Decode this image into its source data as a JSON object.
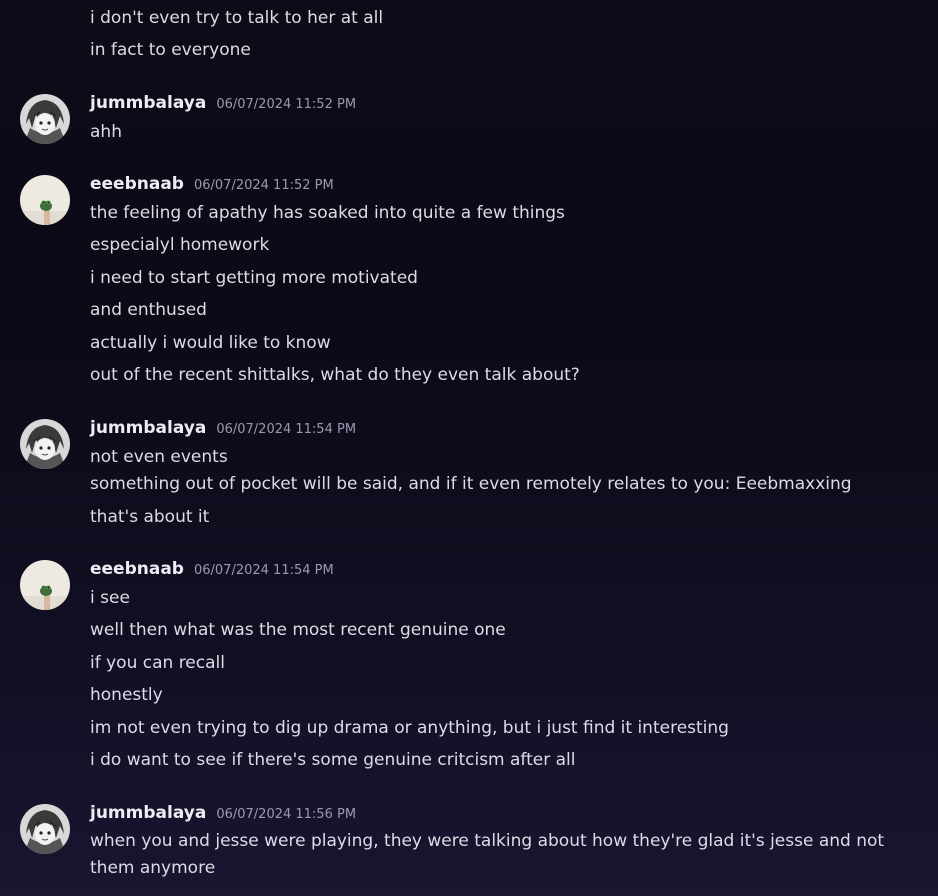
{
  "lead_lines": [
    "i don't even try to talk to her at all",
    "in fact to everyone"
  ],
  "groups": [
    {
      "username": "jummbalaya",
      "timestamp": "06/07/2024 11:52 PM",
      "avatar_icon": "manga-girl-avatar-icon",
      "lines": [
        "ahh"
      ]
    },
    {
      "username": "eeebnaab",
      "timestamp": "06/07/2024 11:52 PM",
      "avatar_icon": "frog-avatar-icon",
      "lines": [
        "the feeling of apathy has soaked into quite a few things",
        "especialyl homework",
        "i need to start getting more motivated",
        "and enthused",
        "actually i would like to know",
        "out of the recent shittalks, what do they even talk about?"
      ]
    },
    {
      "username": "jummbalaya",
      "timestamp": "06/07/2024 11:54 PM",
      "avatar_icon": "manga-girl-avatar-icon",
      "lines": [
        "not even events",
        "something out of pocket will be said, and if it even remotely relates to you: Eeebmaxxing",
        "that's about it"
      ]
    },
    {
      "username": "eeebnaab",
      "timestamp": "06/07/2024 11:54 PM",
      "avatar_icon": "frog-avatar-icon",
      "lines": [
        "i see",
        "well then what was the most recent genuine one",
        "if you can recall",
        "honestly",
        "im not even trying to dig up drama or anything, but i just find it interesting",
        "i do want to see if there's some genuine critcism after all"
      ]
    },
    {
      "username": "jummbalaya",
      "timestamp": "06/07/2024 11:56 PM",
      "avatar_icon": "manga-girl-avatar-icon",
      "lines": [
        "when you and jesse were playing, they were talking about how they're glad it's jesse and not them anymore"
      ]
    }
  ]
}
